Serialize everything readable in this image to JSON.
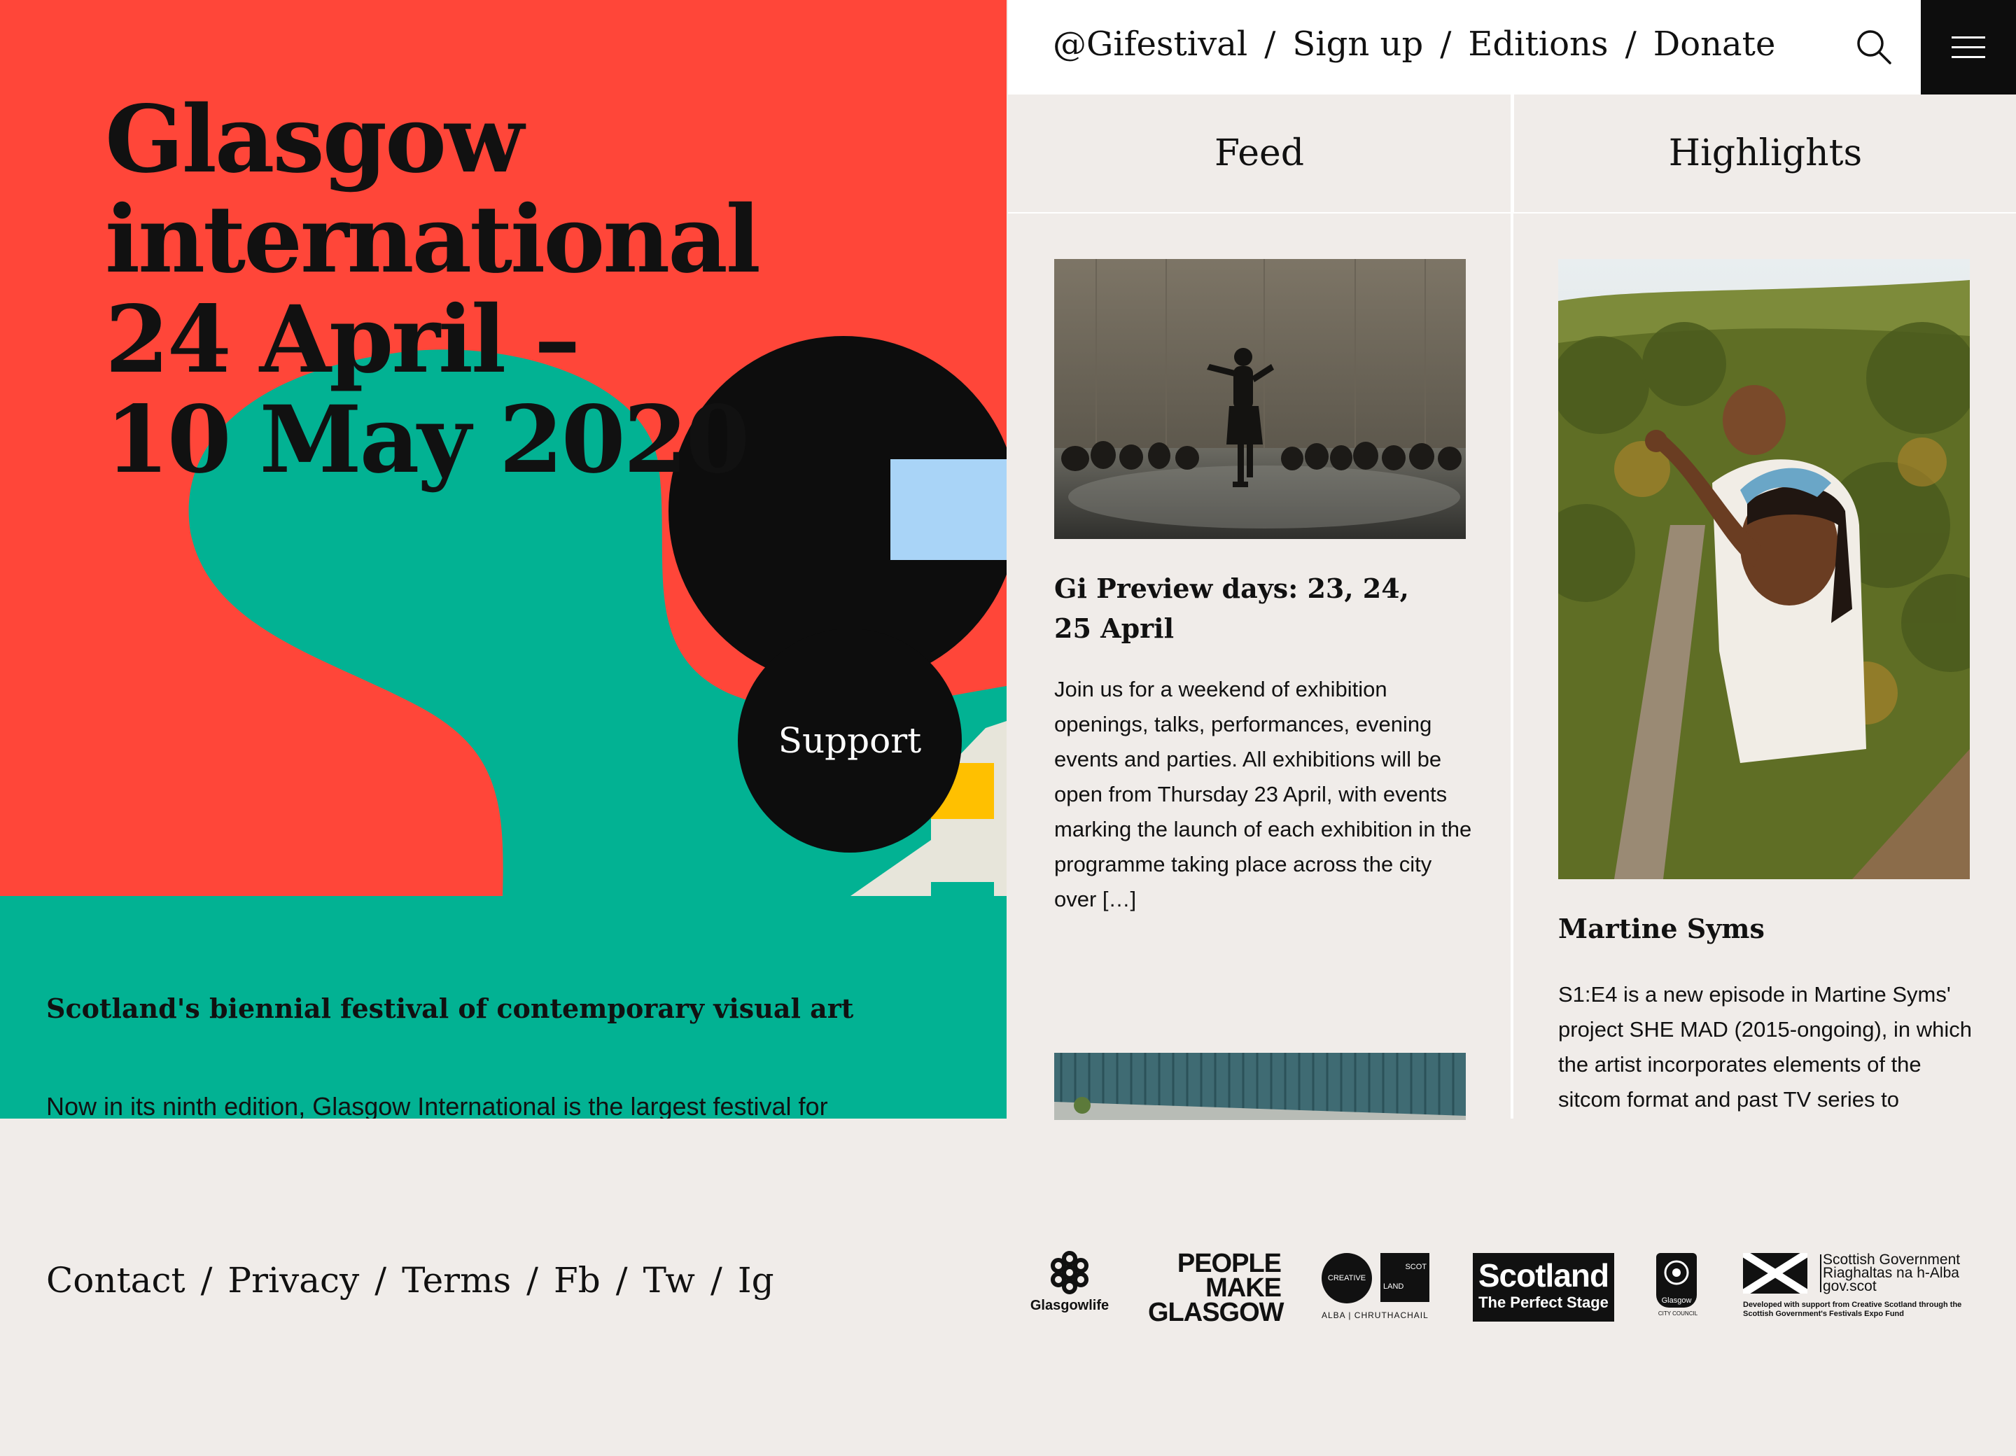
{
  "hero": {
    "title": "Glasgow\ninternational\n24 April –\n10 May 2020",
    "support_label": "Support",
    "tagline": "Scotland's biennial festival of contemporary visual art",
    "intro": "Now in its ninth edition, Glasgow International is the largest festival for",
    "colors": {
      "red": "#ff4639",
      "teal": "#02b293",
      "black": "#0d0d0d",
      "light_blue": "#a9d4f7",
      "yellow": "#ffc000",
      "cream": "#e7e5da"
    }
  },
  "topnav": {
    "links": [
      "@Gifestival",
      "Sign up",
      "Editions",
      "Donate"
    ],
    "separator": "/",
    "search_icon": "search-icon",
    "menu_icon": "hamburger-menu-icon"
  },
  "feed": {
    "heading": "Feed",
    "item": {
      "title": "Gi Preview days: 23, 24, 25 April",
      "text": "Join us for a weekend of exhibition openings, talks, performances, evening events and parties. All exhibitions will be open from Thursday 23 April, with events marking the launch of each exhibition in the programme taking place across the city over […]"
    }
  },
  "highlights": {
    "heading": "Highlights",
    "item": {
      "title": "Martine Syms",
      "text": "S1:E4 is a new episode in Martine Syms' project SHE MAD (2015-ongoing), in which the artist incorporates elements of the sitcom format and past TV series to"
    }
  },
  "footer": {
    "links": [
      "Contact",
      "Privacy",
      "Terms",
      "Fb",
      "Tw",
      "Ig"
    ],
    "separator": "/",
    "logos": {
      "glasgow_life": "Glasgowlife",
      "people_make_glasgow": [
        "PEOPLE",
        "MAKE",
        "GLASGOW"
      ],
      "creative_scotland": {
        "circle": "CREATIVE",
        "square_top": "SCOT",
        "square_bottom": "LAND",
        "tagline": "ALBA | CHRUTHACHAIL"
      },
      "scotland": {
        "title": "Scotland",
        "subtitle": "The Perfect Stage"
      },
      "glasgow_city_council": {
        "name": "Glasgow",
        "sub": "CITY COUNCIL"
      },
      "scot_gov": {
        "lines": [
          "Scottish Government",
          "Riaghaltas na h-Alba",
          "gov.scot"
        ],
        "note": "Developed with support from Creative Scotland through the Scottish Government's Festivals Expo Fund"
      }
    }
  }
}
